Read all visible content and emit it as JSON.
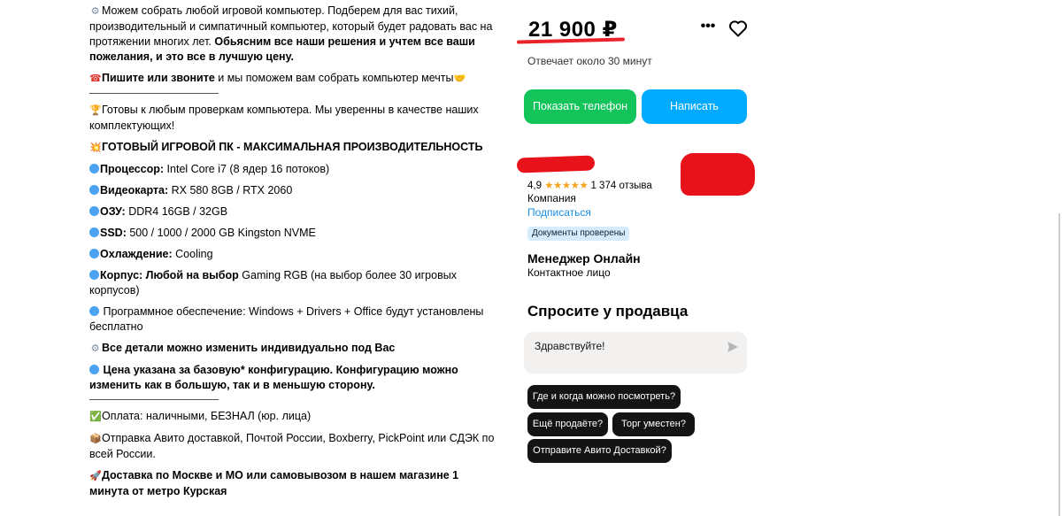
{
  "description": {
    "intro_a": "Можем собрать любой игровой компьютер. Подберем для вас тихий, производительный и симпатичный компьютер, который будет радовать вас на протяжении многих лет. ",
    "intro_b": "Обьясним все наши решения и учтем все ваши пожелания, и это все в лучшую цену.",
    "call_b": "Пишите или звоните",
    "call_t": " и мы поможем вам собрать компьютер мечты",
    "ready": "Готовы к любым проверкам компьютера. Мы уверенны в качестве наших комплектующих!",
    "heading": "ГОТОВЫЙ ИГРОВОЙ ПК - МАКСИМАЛЬНАЯ ПРОИЗВОДИТЕЛЬНОСТЬ",
    "cpu_l": "Процессор:",
    "cpu_v": " Intel Core i7 (8 ядер 16 потоков)",
    "gpu_l": "Видеокарта:",
    "gpu_v": "  RX 580 8GB / RTX 2060",
    "ram_l": "ОЗУ:",
    "ram_v": " DDR4 16GB / 32GB",
    "ssd_l": "SSD:",
    "ssd_v": " 500 / 1000 / 2000 GB Kingston NVME",
    "cool_l": "Охлаждение:",
    "cool_v": " Cooling",
    "case_l": "Корпус: Любой на выбор",
    "case_v": " Gaming RGB (на выбор более 30 игровых корпусов)",
    "software": "Программное обеспечение: Windows + Drivers + Office будут установлены бесплатно",
    "change": "Все детали можно изменить индивидуально под Вас",
    "price_note": "Цена указана за базовую* конфигурацию. Конфигурацию можно изменить как в большую, так и в меньшую сторону.",
    "payment": "Оплата: наличными, БЕЗНАЛ (юр. лица)",
    "shipping": "Отправка Авито доставкой, Почтой России, Boxberry, PickPoint или СДЭК по всей России.",
    "delivery": "Доставка по Москве и МО или самовывозом в нашем магазине 1 минута от метро Курская"
  },
  "icons": {
    "gear": "⚙",
    "phone": "☎",
    "hand": "🤝",
    "trophy": "🏆",
    "boom": "💥",
    "check": "✅",
    "package": "📦",
    "rocket": "🚀"
  },
  "sidebar": {
    "price": "21 900 ₽",
    "more": "•••",
    "reply_time": "Отвечает около 30 минут",
    "phone_button": "Показать телефон",
    "write_button": "Написать",
    "rating_value": "4,9",
    "stars": "★★★★★",
    "reviews": "1 374 отзыва",
    "seller_type": "Компания",
    "subscribe": "Подписаться",
    "verified_badge": "Документы проверены",
    "manager_name": "Менеджер Онлайн",
    "manager_role": "Контактное лицо",
    "ask_title": "Спросите у продавца",
    "message_text": "Здравствуйте!",
    "quick_questions": [
      "Где и когда можно посмотреть?",
      "Ещё продаёте?",
      "Торг уместен?",
      "Отправите Авито Доставкой?"
    ]
  },
  "colors": {
    "phone_button": "#12c45a",
    "write_button": "#00aaff",
    "link": "#1a8de6",
    "chip": "#141414",
    "redaction": "#e8131a"
  }
}
